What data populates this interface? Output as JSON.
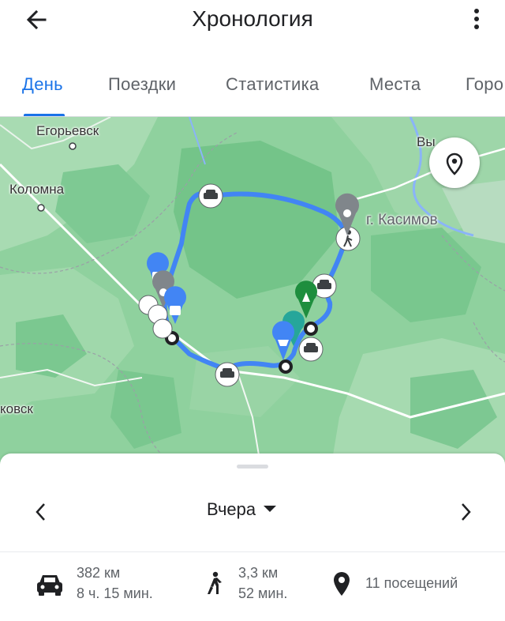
{
  "header": {
    "title": "Хронология",
    "back_icon": "arrow-back-icon",
    "menu_icon": "more-vert-icon"
  },
  "tabs": [
    {
      "label": "День",
      "active": true
    },
    {
      "label": "Поездки",
      "active": false
    },
    {
      "label": "Статистика",
      "active": false
    },
    {
      "label": "Места",
      "active": false
    },
    {
      "label": "Горо",
      "active": false
    }
  ],
  "map": {
    "places": {
      "egorievsk": "Егорьевск",
      "kolomna": "Коломна",
      "kasimov": "г. Касимов",
      "vy": "Вы",
      "kovsk": "ковск"
    },
    "route_color": "#4285f4",
    "locate_icon": "location-pin-icon"
  },
  "sheet": {
    "date_label": "Вчера",
    "prev_icon": "chevron-left-icon",
    "next_icon": "chevron-right-icon",
    "stats": {
      "car": {
        "distance": "382 км",
        "duration": "8 ч. 15 мин.",
        "icon": "car-icon"
      },
      "walk": {
        "distance": "3,3 км",
        "duration": "52 мин.",
        "icon": "walk-icon"
      },
      "visits": {
        "label": "11 посещений",
        "icon": "place-icon"
      }
    }
  }
}
